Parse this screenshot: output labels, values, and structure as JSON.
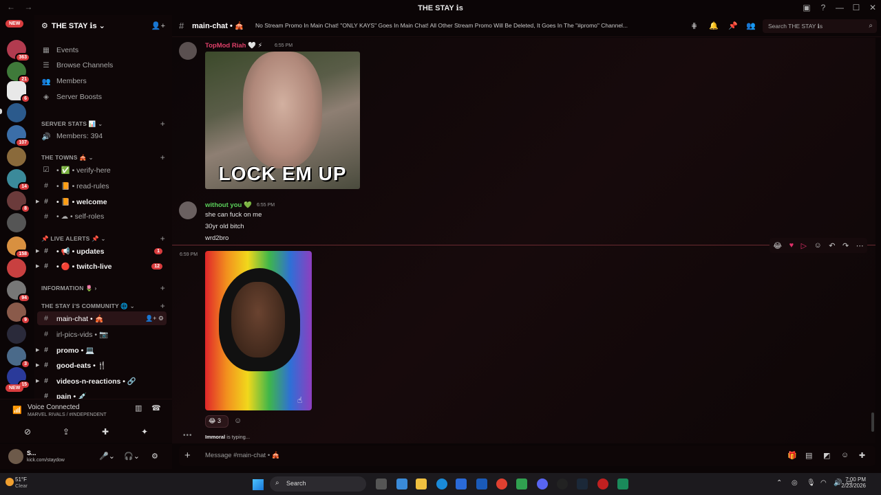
{
  "window": {
    "title": "THE STAY ℹ︎s",
    "nav_back": "←",
    "nav_fwd": "→"
  },
  "servers": {
    "new_top": "NEW",
    "new_bottom": "NEW",
    "badges": [
      "363",
      "21",
      "6",
      "",
      "107",
      "",
      "14",
      "8",
      "",
      "158",
      "",
      "94",
      "9",
      "",
      "3",
      "15"
    ]
  },
  "sidebar": {
    "server_name": "THE STAY ℹ︎s",
    "top_items": [
      {
        "icon": "calendar-icon",
        "glyph": "▦",
        "label": "Events"
      },
      {
        "icon": "browse-icon",
        "glyph": "☰",
        "label": "Browse Channels"
      },
      {
        "icon": "members-icon",
        "glyph": "👥",
        "label": "Members"
      },
      {
        "icon": "boost-icon",
        "glyph": "◈",
        "label": "Server Boosts"
      }
    ],
    "categories": {
      "server_stats": "SERVER STATS 📊",
      "the_towns": "THE TOWNS 🎪",
      "live_alerts": "📌 LIVE ALERTS 📌",
      "information": "INFORMATION 🌷",
      "community": "THE STAY ℹ︎'S COMMUNITY 🌐"
    },
    "members_count": "Members: 394",
    "channels": {
      "verify": "• ✅ • verify-here",
      "rules": "• 📙 • read-rules",
      "welcome": "• 📙 • welcome",
      "self_roles": "• ☁ • self-roles",
      "updates": "• 📢 • updates",
      "twitch": "• 🔴 • twitch-live",
      "main_chat": "main-chat • 🎪",
      "irl_pics": "irl-pics-vids • 📷",
      "promo": "promo • 💻",
      "good_eats": "good-eats • 🍴",
      "videos": "videos-n-reactions • 🔗",
      "pain": "pain • 💉"
    },
    "counts": {
      "updates": "1",
      "twitch": "12"
    }
  },
  "voice": {
    "status": "Voice Connected",
    "channel": "MARVEL RIVALS / #INDEPENDENT"
  },
  "user": {
    "name": "S...",
    "status": "kick.com/staydow"
  },
  "header": {
    "channel": "main-chat • 🎪",
    "topic": "No Stream Promo In Main Chat! \"ONLY KAYS\" Goes In Main Chat! All Other Stream Promo Will Be Deleted, It Goes In The \"#promo\" Channel...",
    "search_placeholder": "Search THE STAY ℹ︎s"
  },
  "messages": [
    {
      "author": "TopMod Riah",
      "badge": "🤍 ⚡",
      "time": "6:55 PM",
      "gif_caption": "LOCK EM UP",
      "color": "#e0406a"
    },
    {
      "author": "without you",
      "badge": "💚",
      "time": "6:55 PM",
      "lines": [
        "she can fuck on me",
        "30yr old bitch",
        "wrd2bro"
      ],
      "color": "#5ad05a"
    },
    {
      "time": "6:59 PM",
      "reaction_emoji": "😂",
      "reaction_count": "3"
    }
  ],
  "typing": {
    "user": "Immoral",
    "text": "is typing..."
  },
  "composer": {
    "placeholder": "Message #main-chat • 🎪"
  },
  "taskbar": {
    "temp": "51°F",
    "condition": "Clear",
    "search": "Search",
    "time": "7:00 PM",
    "date": "2/23/2026"
  }
}
